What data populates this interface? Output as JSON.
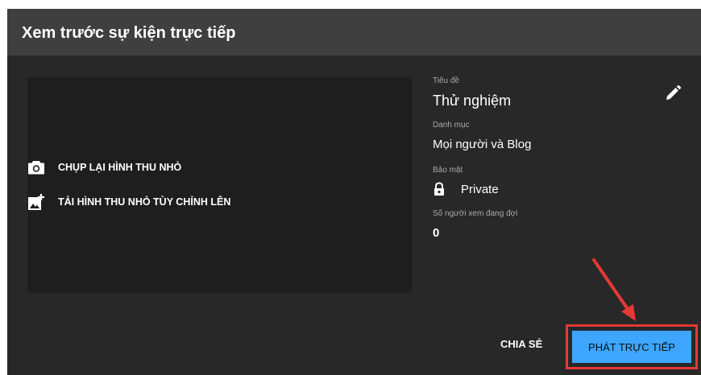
{
  "dialog": {
    "title": "Xem trước sự kiện trực tiếp"
  },
  "thumbnail": {
    "capture_label": "CHỤP LẠI HÌNH THU NHỎ",
    "upload_label": "TẢI HÌNH THU NHỎ TÙY CHỈNH LÊN",
    "capture_icon": "camera-icon",
    "upload_icon": "add-photo-icon"
  },
  "details": {
    "title_label": "Tiêu đề",
    "title_value": "Thử nghiệm",
    "category_label": "Danh mục",
    "category_value": "Mọi người và Blog",
    "privacy_label": "Bảo mật",
    "privacy_value": "Private",
    "privacy_icon": "lock-icon",
    "viewers_label": "Số người xem đang đợi",
    "viewers_value": "0",
    "edit_icon": "pencil-icon"
  },
  "actions": {
    "share_label": "CHIA SẺ",
    "go_live_label": "PHÁT TRỰC TIẾP"
  },
  "colors": {
    "background": "#282828",
    "header": "#3f3f3f",
    "accent": "#3ea6ff",
    "highlight": "#e53935"
  }
}
